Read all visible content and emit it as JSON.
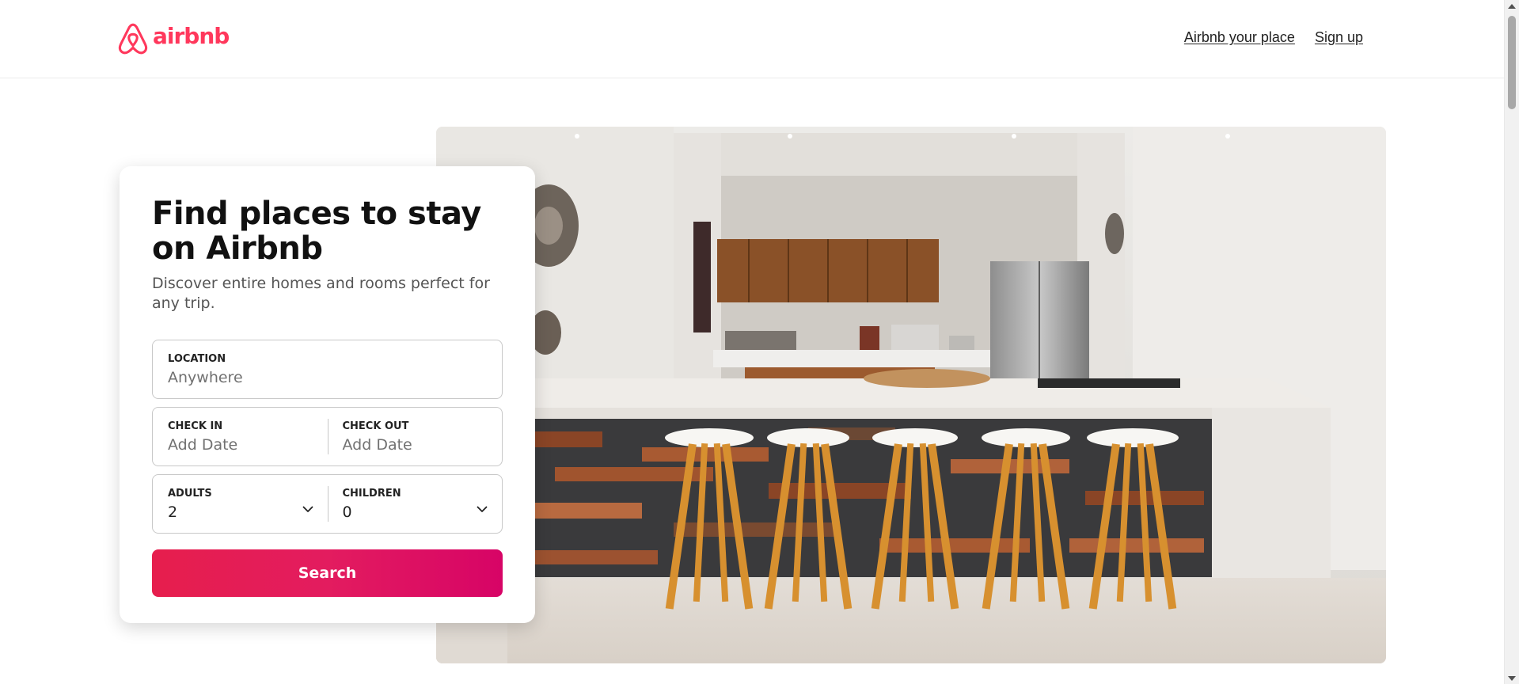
{
  "header": {
    "logo_text": "airbnb",
    "nav": {
      "host_link": "Airbnb your place",
      "signup_link": "Sign up"
    }
  },
  "search_card": {
    "title": "Find places to stay on Airbnb",
    "subtitle": "Discover entire homes and rooms perfect for any trip.",
    "location": {
      "label": "LOCATION",
      "placeholder": "Anywhere"
    },
    "check_in": {
      "label": "CHECK IN",
      "placeholder": "Add Date"
    },
    "check_out": {
      "label": "CHECK OUT",
      "placeholder": "Add Date"
    },
    "adults": {
      "label": "ADULTS",
      "value": "2"
    },
    "children": {
      "label": "CHILDREN",
      "value": "0"
    },
    "search_button": "Search"
  },
  "colors": {
    "brand": "#ff385c",
    "button_start": "#e61e4d",
    "button_end": "#d70466",
    "text": "#222222",
    "muted": "#717171"
  },
  "icons": {
    "logo": "airbnb-belo-icon",
    "dropdown": "chevron-down-icon"
  }
}
